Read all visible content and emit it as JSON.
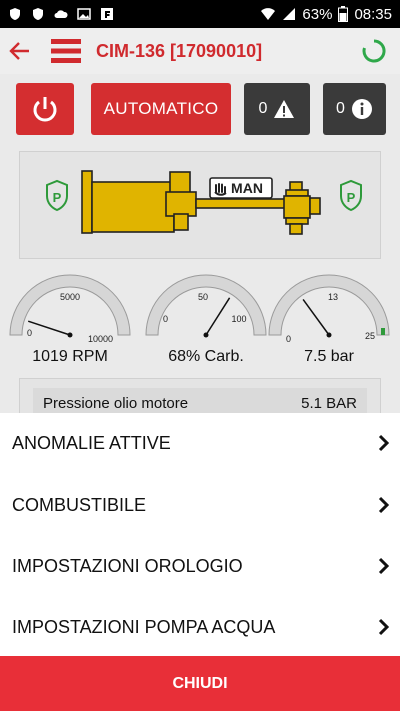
{
  "status_bar": {
    "battery": "63%",
    "time": "08:35"
  },
  "app_bar": {
    "title": "CIM-136 [17090010]"
  },
  "controls": {
    "mode_label": "AUTOMATICO",
    "warning_count": "0",
    "info_count": "0"
  },
  "diagram": {
    "mode_badge": "MAN",
    "pump_color": "#e0b400",
    "shield_color": "#2e9a3a"
  },
  "gauges": [
    {
      "label": "1019 RPM",
      "min": "0",
      "mid": "5000",
      "max": "10000",
      "value": 1019,
      "range": 10000
    },
    {
      "label": "68% Carb.",
      "min": "0",
      "mid": "50",
      "max": "100",
      "value": 68,
      "range": 100
    },
    {
      "label": "7.5 bar",
      "min": "0",
      "mid": "13",
      "max": "25",
      "value": 7.5,
      "range": 25
    }
  ],
  "readings": {
    "oil_pressure_label": "Pressione olio motore",
    "oil_pressure_value": "5.1 BAR"
  },
  "sheet": {
    "items": [
      {
        "label": "ANOMALIE ATTIVE"
      },
      {
        "label": "COMBUSTIBILE"
      },
      {
        "label": "IMPOSTAZIONI OROLOGIO"
      },
      {
        "label": "IMPOSTAZIONI POMPA ACQUA"
      }
    ],
    "close_label": "CHIUDI"
  },
  "colors": {
    "accent": "#d42e30",
    "dark_button": "#3a3a3a",
    "close_bar": "#e82f38"
  }
}
